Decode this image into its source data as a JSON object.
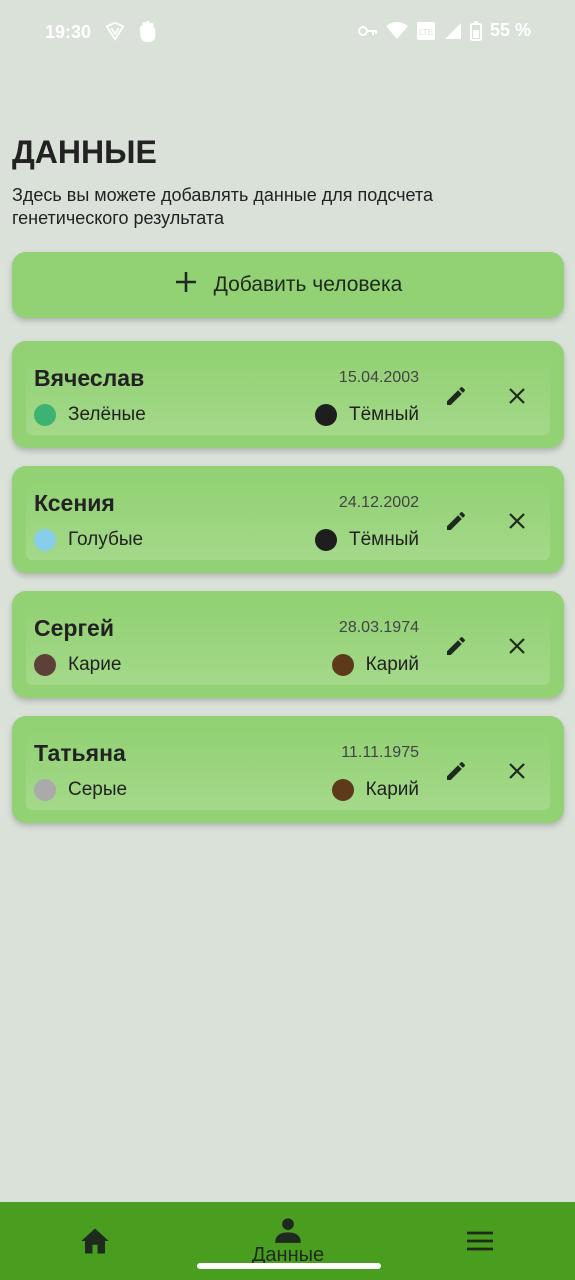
{
  "status_bar": {
    "time": "19:30",
    "battery": "55 %",
    "left_icons": [
      "vpn-icon",
      "hand-icon"
    ],
    "right_icons": [
      "key-icon",
      "wifi-icon",
      "lte-icon",
      "signal-icon",
      "battery-icon"
    ]
  },
  "header": {
    "title": "ДАННЫЕ",
    "subtitle": "Здесь вы можете добавлять данные для подсчета генетического результата"
  },
  "add_button": {
    "label": "Добавить человека",
    "icon": "plus-icon"
  },
  "people": [
    {
      "name": "Вячеслав",
      "date": "15.04.2003",
      "eye_label": "Зелёные",
      "eye_color": "#3cb371",
      "hair_label": "Тёмный",
      "hair_color": "#1e1e1e"
    },
    {
      "name": "Ксения",
      "date": "24.12.2002",
      "eye_label": "Голубые",
      "eye_color": "#87ceeb",
      "hair_label": "Тёмный",
      "hair_color": "#1e1e1e"
    },
    {
      "name": "Сергей",
      "date": "28.03.1974",
      "eye_label": "Карие",
      "eye_color": "#5d4037",
      "hair_label": "Карий",
      "hair_color": "#5d3a1a"
    },
    {
      "name": "Татьяна",
      "date": "11.11.1975",
      "eye_label": "Серые",
      "eye_color": "#aaaaaa",
      "hair_label": "Карий",
      "hair_color": "#5d3a1a"
    }
  ],
  "bottom_nav": {
    "items": [
      {
        "icon": "home-icon",
        "label": ""
      },
      {
        "icon": "person-icon",
        "label": "Данные"
      },
      {
        "icon": "menu-icon",
        "label": ""
      }
    ]
  },
  "colors": {
    "background": "#d9e1d9",
    "card": "#92d174",
    "nav": "#4a9e1f"
  }
}
